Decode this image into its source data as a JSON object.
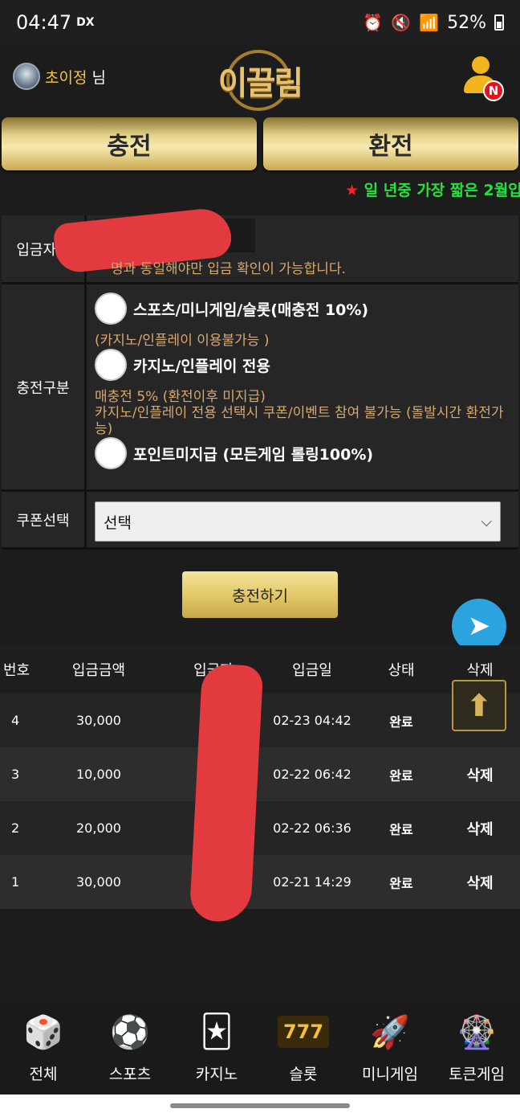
{
  "status_bar": {
    "time": "04:47",
    "network": "DX",
    "battery": "52%"
  },
  "header": {
    "user_name": "초이정",
    "user_suffix": "님",
    "logo_text": "이끌림",
    "notification_badge": "N"
  },
  "actions": {
    "charge_label": "충전",
    "exchange_label": "환전"
  },
  "marquee": {
    "star": "★",
    "text": " 일 년중 가장 짧은 2월입"
  },
  "form": {
    "depositor_label": "입금자명",
    "depositor_note": "명과 동일해야만 입금 확인이 가능합니다.",
    "charge_type_label": "충전구분",
    "options": [
      {
        "label": "스포츠/미니게임/슬롯(매충전 10%)",
        "note": "(카지노/인플레이 이용불가능 )"
      },
      {
        "label": "카지노/인플레이 전용",
        "note": "매충전 5% (환전이후 미지급)\n카지노/인플레이 전용 선택시 쿠폰/이벤트 참여 불가능 (돌발시간 환전가능)"
      },
      {
        "label": "포인트미지급 (모든게임 롤링100%)",
        "note": ""
      }
    ],
    "coupon_label": "쿠폰선택",
    "coupon_selected": "선택",
    "submit_label": "충전하기"
  },
  "table": {
    "headers": [
      "번호",
      "입금금액",
      "입금자",
      "입금일",
      "상태",
      "삭제"
    ],
    "rows": [
      {
        "no": "4",
        "amount": "30,000",
        "date": "02-23 04:42",
        "status": "완료",
        "action": ""
      },
      {
        "no": "3",
        "amount": "10,000",
        "date": "02-22 06:42",
        "status": "완료",
        "action": "삭제"
      },
      {
        "no": "2",
        "amount": "20,000",
        "date": "02-22 06:36",
        "status": "완료",
        "action": "삭제"
      },
      {
        "no": "1",
        "amount": "30,000",
        "date": "02-21 14:29",
        "status": "완료",
        "action": "삭제"
      }
    ]
  },
  "bottom_nav": [
    {
      "label": "전체",
      "icon": "dice-icon"
    },
    {
      "label": "스포츠",
      "icon": "soccer-ball-icon"
    },
    {
      "label": "카지노",
      "icon": "cards-icon"
    },
    {
      "label": "슬롯",
      "icon": "slot-777-icon"
    },
    {
      "label": "미니게임",
      "icon": "rocket-icon"
    },
    {
      "label": "토큰게임",
      "icon": "roulette-icon"
    }
  ],
  "colors": {
    "gold": "#e6d48c",
    "accent_green": "#22e33a",
    "note_orange": "#d9a86b",
    "telegram": "#2aa3df"
  }
}
